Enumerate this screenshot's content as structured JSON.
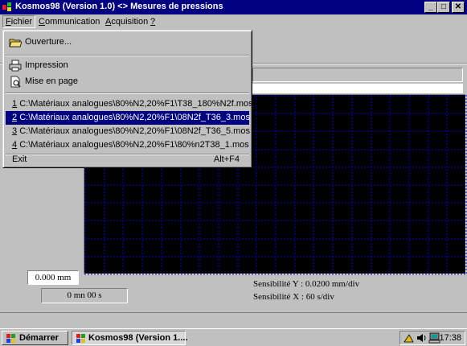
{
  "window": {
    "title": "Kosmos98 (Version 1.0) <> Mesures de pressions",
    "minimize": "_",
    "maximize": "□",
    "close": "✕"
  },
  "menubar": {
    "items": [
      {
        "label": "Fichier",
        "mnemonic": "F"
      },
      {
        "label": "Communication",
        "mnemonic": "C"
      },
      {
        "label": "Acquisition",
        "mnemonic": "A"
      },
      {
        "label": "?",
        "mnemonic": "?"
      }
    ]
  },
  "file_menu": {
    "ouverture": "Ouverture...",
    "impression": "Impression",
    "mise_en_page": "Mise en page",
    "recent": [
      {
        "num": "1",
        "path": "C:\\Matériaux analogues\\80%N2,20%F1\\T38_180%N2f.mos"
      },
      {
        "num": "2",
        "path": "C:\\Matériaux analogues\\80%N2,20%F1\\08N2f_T36_3.mos"
      },
      {
        "num": "3",
        "path": "C:\\Matériaux analogues\\80%N2,20%F1\\08N2f_T36_5.mos"
      },
      {
        "num": "4",
        "path": "C:\\Matériaux analogues\\80%N2,20%F1\\80%n2T38_1.mos"
      }
    ],
    "selected_recent": 1,
    "exit": "Exit",
    "exit_shortcut": "Alt+F4"
  },
  "readouts": {
    "value_y": "0.000 mm",
    "time": "0 mn 00 s",
    "sensitivity_y": "Sensibilité Y : 0.0200 mm/div",
    "sensitivity_x": "Sensibilité X : 60 s/div"
  },
  "taskbar": {
    "start": "Démarrer",
    "task": "Kosmos98 (Version 1....",
    "clock": "17:38"
  },
  "colors": {
    "titlebar": "#000080",
    "face": "#c0c0c0",
    "graph_background": "#000000",
    "grid": "#0000c8",
    "selection": "#000080"
  },
  "icons": [
    "app-icon",
    "open-folder-icon",
    "printer-icon",
    "page-setup-icon",
    "windows-flag-icon",
    "speaker-icon",
    "network-icon"
  ]
}
